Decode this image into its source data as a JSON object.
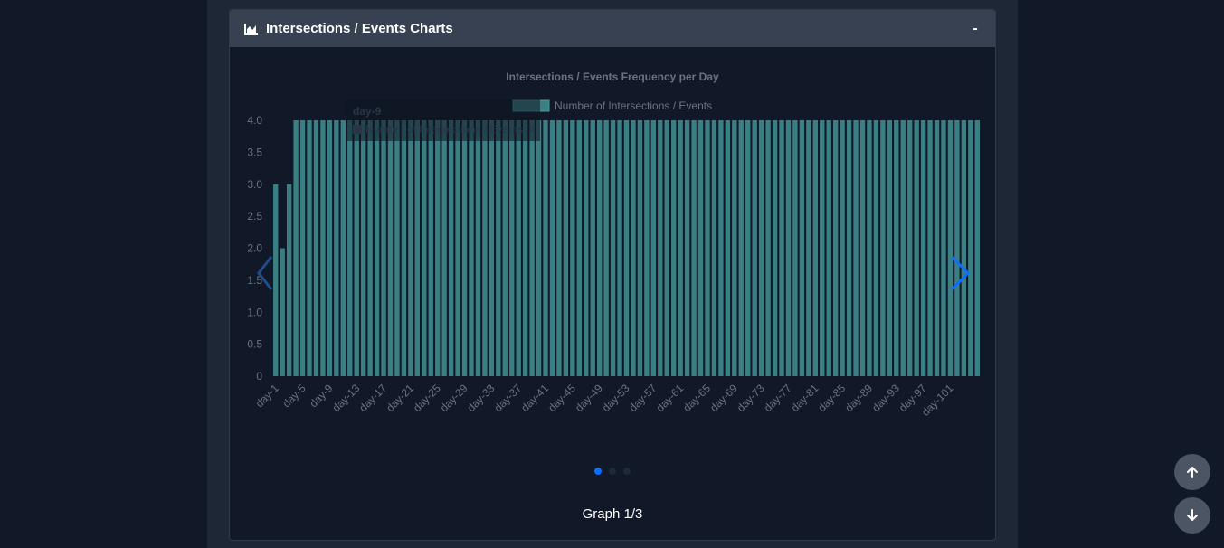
{
  "header": {
    "title": "Intersections / Events Charts",
    "collapse_label": "-",
    "icon": "area-chart-icon"
  },
  "chart_data": {
    "type": "bar",
    "title": "Intersections / Events Frequency per Day",
    "series": [
      {
        "name": "Number of Intersections / Events",
        "color": "#3a7f83",
        "values": [
          3,
          2,
          3,
          4,
          4,
          4,
          4,
          4,
          4,
          4,
          4,
          4,
          4,
          4,
          4,
          4,
          4,
          4,
          4,
          4,
          4,
          4,
          4,
          4,
          4,
          4,
          4,
          4,
          4,
          4,
          4,
          4,
          4,
          4,
          4,
          4,
          4,
          4,
          4,
          4,
          4,
          4,
          4,
          4,
          4,
          4,
          4,
          4,
          4,
          4,
          4,
          4,
          4,
          4,
          4,
          4,
          4,
          4,
          4,
          4,
          4,
          4,
          4,
          4,
          4,
          4,
          4,
          4,
          4,
          4,
          4,
          4,
          4,
          4,
          4,
          4,
          4,
          4,
          4,
          4,
          4,
          4,
          4,
          4,
          4,
          4,
          4,
          4,
          4,
          4,
          4,
          4,
          4,
          4,
          4,
          4,
          4,
          4,
          4,
          4,
          4,
          4,
          4,
          4,
          4
        ]
      }
    ],
    "categories_prefix": "day-",
    "category_count": 103,
    "xtick_labels": [
      "day-1",
      "day-5",
      "day-9",
      "day-13",
      "day-17",
      "day-21",
      "day-25",
      "day-29",
      "day-33",
      "day-37",
      "day-41",
      "day-45",
      "day-49",
      "day-53",
      "day-57",
      "day-61",
      "day-65",
      "day-69",
      "day-73",
      "day-77",
      "day-81",
      "day-85",
      "day-89",
      "day-93",
      "day-97",
      "day-101"
    ],
    "ytick_labels": [
      "4.0",
      "3.5",
      "3.0",
      "2.5",
      "2.0",
      "1.5",
      "1.0",
      "0.5",
      "0"
    ],
    "ylim": [
      0,
      4
    ],
    "legend_position": "top",
    "tooltip": {
      "title": "day-9",
      "body": "Number of Intersections / Events: 4"
    },
    "text_color": "#6b7280"
  },
  "carousel": {
    "caption": "Graph 1/3",
    "total_slides": 3,
    "active_slide": 1,
    "accent_color": "#0d6efd"
  },
  "scroll_buttons": {
    "up_icon": "arrow-up-icon",
    "down_icon": "arrow-down-icon"
  }
}
